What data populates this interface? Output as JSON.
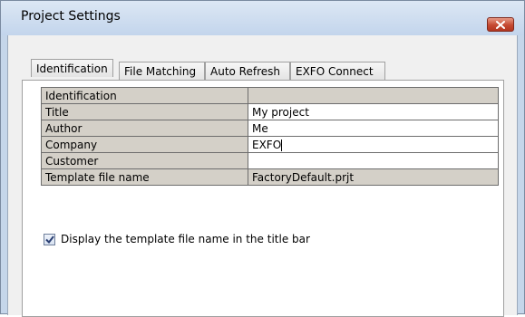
{
  "window": {
    "title": "Project Settings",
    "close_icon": "close-icon"
  },
  "tabs": [
    {
      "label": "Identification",
      "active": true
    },
    {
      "label": "File Matching",
      "active": false
    },
    {
      "label": "Auto Refresh",
      "active": false
    },
    {
      "label": "EXFO Connect",
      "active": false
    }
  ],
  "table": {
    "header": {
      "label": "Identification",
      "value": ""
    },
    "rows": [
      {
        "label": "Title",
        "value": "My project"
      },
      {
        "label": "Author",
        "value": "Me"
      },
      {
        "label": "Company",
        "value": "EXFO"
      },
      {
        "label": "Customer",
        "value": ""
      },
      {
        "label": "Template file name",
        "value": "FactoryDefault.prjt"
      }
    ]
  },
  "options": {
    "display_template_label": "Display the template file name in the title bar",
    "display_template_checked": true
  },
  "colors": {
    "title_bar": "#c5d6ea",
    "close_button": "#c54a32",
    "readonly_cell": "#d4d0c8"
  }
}
